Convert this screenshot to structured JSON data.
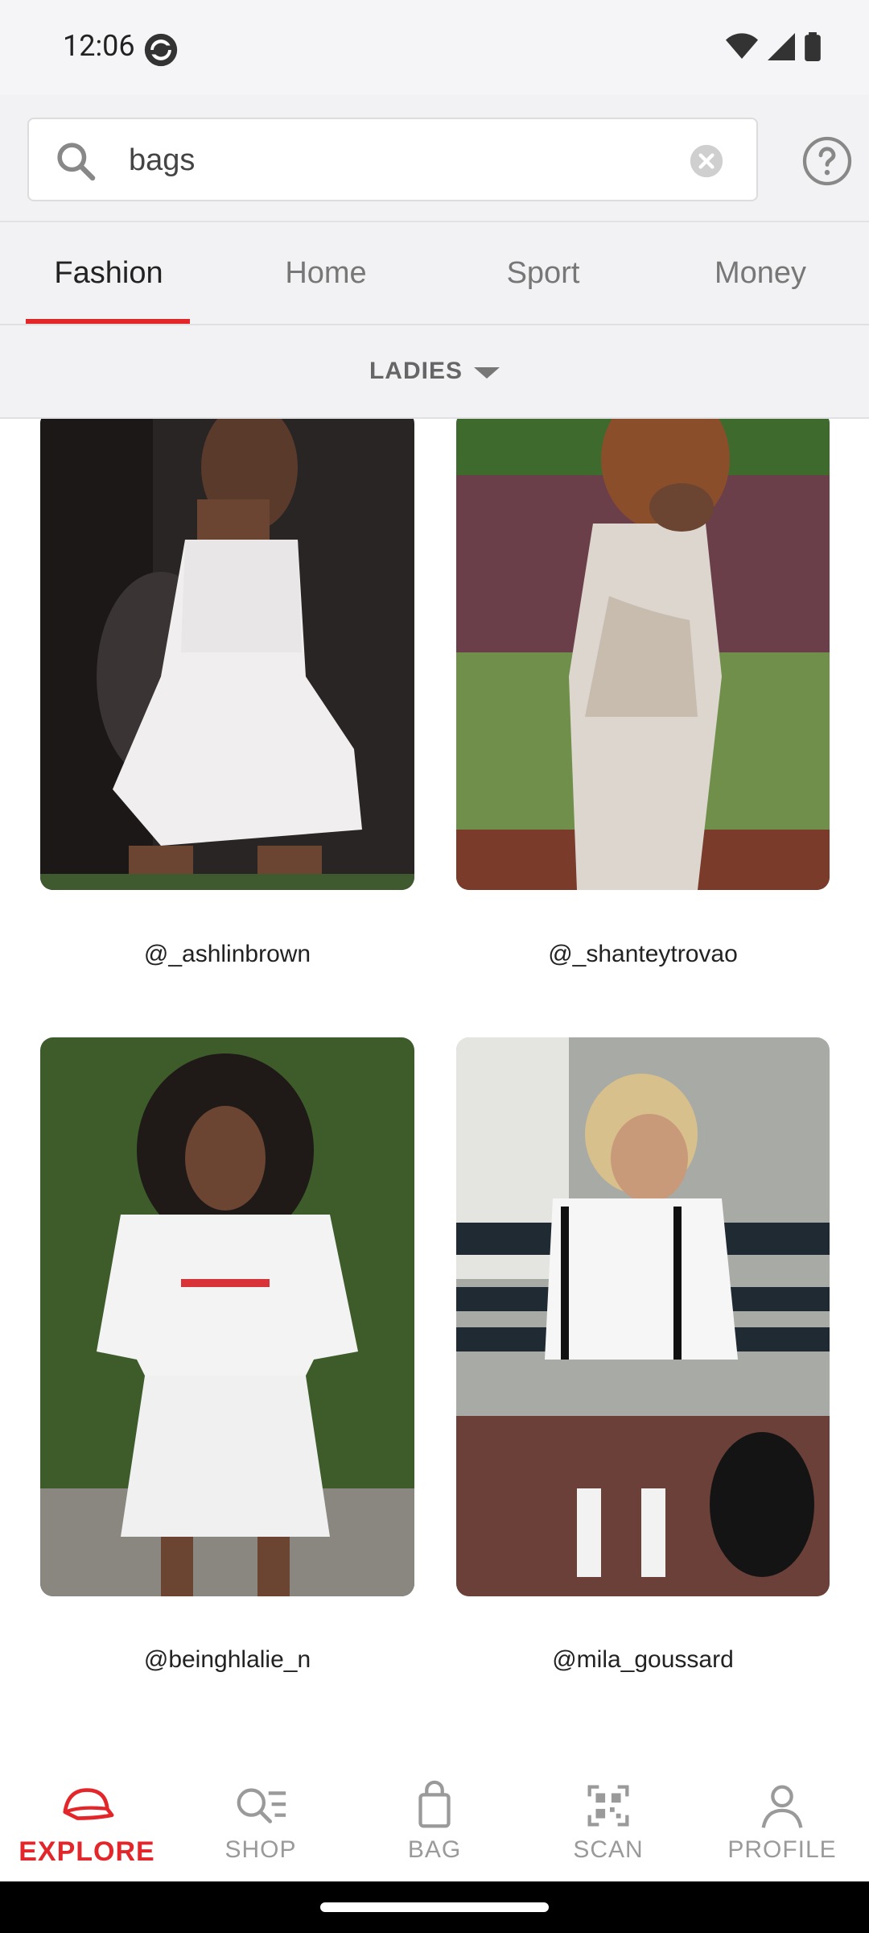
{
  "status": {
    "time": "12:06"
  },
  "search": {
    "query": "bags"
  },
  "tabs": [
    {
      "label": "Fashion",
      "active": true
    },
    {
      "label": "Home"
    },
    {
      "label": "Sport"
    },
    {
      "label": "Money"
    }
  ],
  "filter": {
    "label": "LADIES"
  },
  "feed": {
    "items": [
      {
        "handle": "@_ashlinbrown"
      },
      {
        "handle": "@_shanteytrovao"
      },
      {
        "handle": "@beinghlalie_n"
      },
      {
        "handle": "@mila_goussard"
      }
    ]
  },
  "nav": {
    "items": [
      {
        "label": "EXPLORE",
        "icon": "cap-icon",
        "active": true
      },
      {
        "label": "SHOP",
        "icon": "shop-search-icon"
      },
      {
        "label": "BAG",
        "icon": "shopping-bag-icon"
      },
      {
        "label": "SCAN",
        "icon": "qr-scan-icon"
      },
      {
        "label": "PROFILE",
        "icon": "profile-icon"
      }
    ]
  },
  "colors": {
    "accent": "#e2262a",
    "inactive": "#9a9a9a",
    "background": "#f2f2f4"
  }
}
